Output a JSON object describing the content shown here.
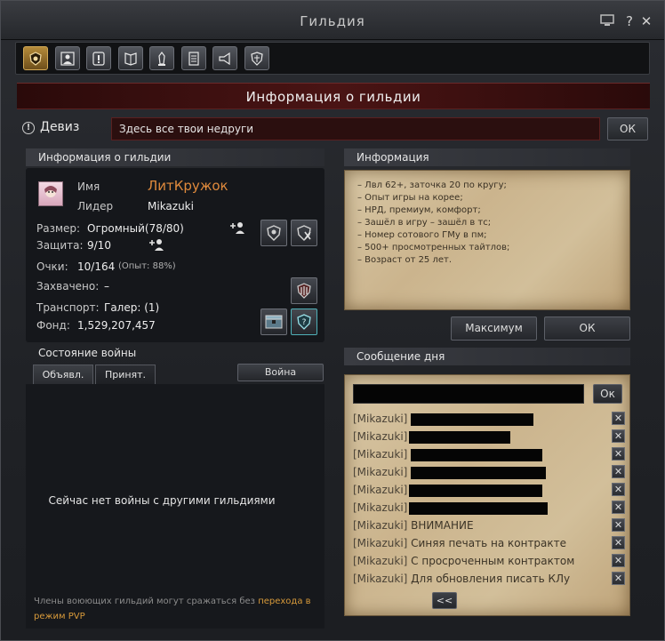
{
  "window": {
    "title": "Гильдия"
  },
  "toolbar": {
    "icons": [
      "guild-crest-icon",
      "members-icon",
      "alert-icon",
      "quest-icon",
      "vault-icon",
      "document-icon",
      "megaphone-icon",
      "shield-icon"
    ]
  },
  "banner": {
    "title": "Информация о гильдии"
  },
  "motto": {
    "label": "Девиз",
    "value": "Здесь все твои недруги",
    "ok_label": "ОК"
  },
  "guild_info": {
    "header": "Информация о гильдии",
    "name_label": "Имя",
    "name_value": "ЛитКружок",
    "leader_label": "Лидер",
    "leader_value": "Mikazuki",
    "size_label": "Размер:",
    "size_value": "Огромный(78/80)",
    "defense_label": "Защита:",
    "defense_value": "9/10",
    "points_label": "Очки:",
    "points_value": "10/164",
    "points_exp": "(Опыт: 88%)",
    "captured_label": "Захвачено:",
    "captured_value": "–",
    "transport_label": "Транспорт:",
    "transport_value": "Галер: (1)",
    "fund_label": "Фонд:",
    "fund_value": "1,529,207,457"
  },
  "info": {
    "header": "Информация",
    "lines": [
      "– Лвл 62+, заточка 20 по кругу;",
      "– Опыт игры на корее;",
      "– НРД, премиум, комфорт;",
      "– Зашёл в игру – зашёл в тс;",
      "– Номер сотового ГМу в пм;",
      "– 500+ просмотренных тайтлов;",
      "– Возраст от 25 лет."
    ],
    "max_button": "Максимум",
    "ok_button": "ОК"
  },
  "war": {
    "header": "Состояние войны",
    "tab_declared": "Объявл.",
    "tab_accepted": "Принят.",
    "war_button": "Война",
    "empty_text": "Сейчас нет войны с другими гильдиями",
    "footer_text": "Члены воюющих гильдий могут сражаться без ",
    "footer_link": "перехода в режим PVP"
  },
  "motd": {
    "header": "Сообщение дня",
    "ok_button": "Ок",
    "messages": [
      {
        "author": "[Mikazuki]",
        "text": ""
      },
      {
        "author": "[Mikazuki]",
        "text": ""
      },
      {
        "author": "[Mikazuki]",
        "text": ""
      },
      {
        "author": "[Mikazuki]",
        "text": ""
      },
      {
        "author": "[Mikazuki]",
        "text": ""
      },
      {
        "author": "[Mikazuki]",
        "text": ""
      },
      {
        "author": "[Mikazuki]",
        "text": "ВНИМАНИЕ"
      },
      {
        "author": "[Mikazuki]",
        "text": "Синяя печать на контракте"
      },
      {
        "author": "[Mikazuki]",
        "text": "С просроченным контрактом"
      },
      {
        "author": "[Mikazuki]",
        "text": "Для обновления писать КЛу"
      }
    ],
    "prev_button": "<<"
  },
  "colors": {
    "accent_orange": "#e08a3c",
    "link_orange": "#d89a3a",
    "banner_red": "#4a1414"
  }
}
